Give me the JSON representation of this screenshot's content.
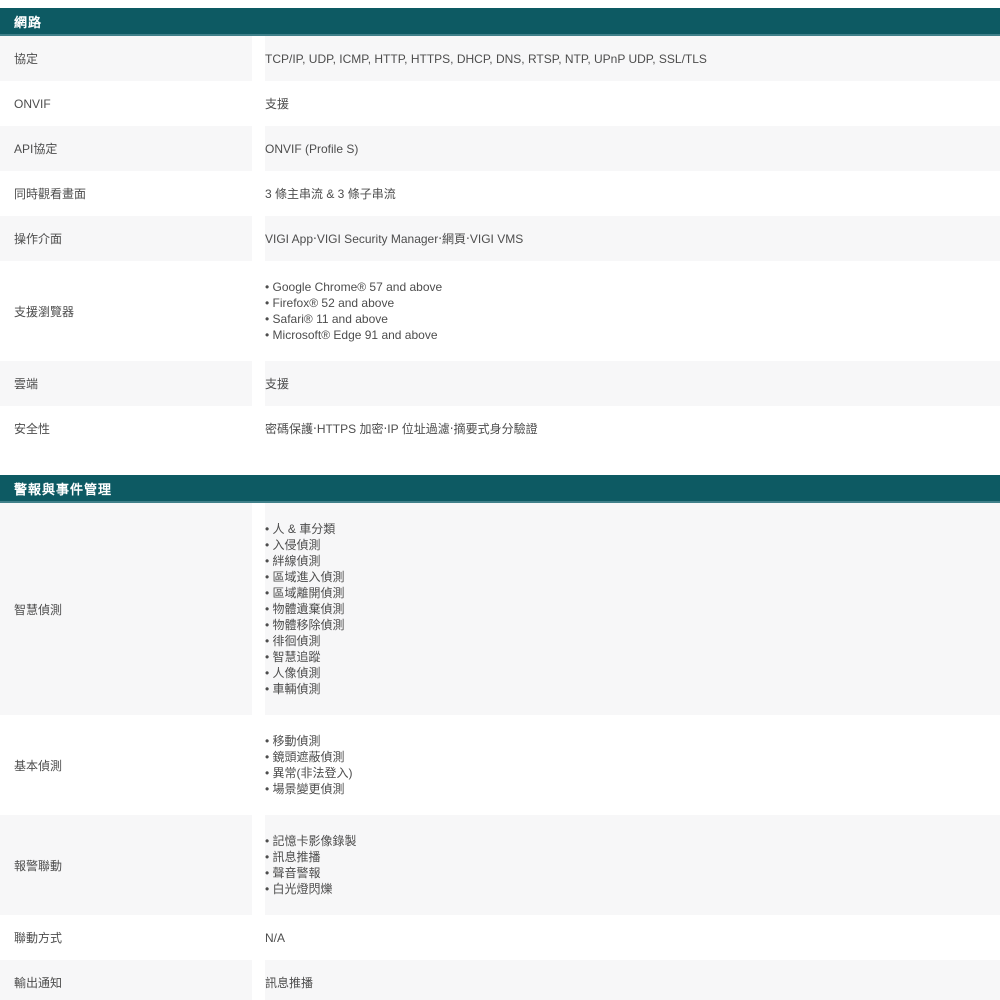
{
  "colors": {
    "header_bg": "#0d5a63",
    "header_text": "#ffffff",
    "alt_row_bg": "#f7f7f8",
    "body_text": "#4d4d4d"
  },
  "sections": [
    {
      "title": "網路",
      "rows": [
        {
          "label": "協定",
          "value": "TCP/IP, UDP, ICMP, HTTP, HTTPS, DHCP, DNS, RTSP, NTP, UPnP UDP, SSL/TLS"
        },
        {
          "label": "ONVIF",
          "value": "支援"
        },
        {
          "label": "API協定",
          "value": "ONVIF (Profile S)"
        },
        {
          "label": "同時觀看畫面",
          "value": "3 條主串流 & 3 條子串流"
        },
        {
          "label": "操作介面",
          "value": "VIGI App‧VIGI Security Manager‧網頁‧VIGI VMS"
        },
        {
          "label": "支援瀏覽器",
          "items": [
            "Google Chrome® 57 and above",
            "Firefox® 52 and above",
            "Safari® 11 and above",
            "Microsoft® Edge 91 and above"
          ]
        },
        {
          "label": "雲端",
          "value": "支援"
        },
        {
          "label": "安全性",
          "value": "密碼保護‧HTTPS 加密‧IP 位址過濾‧摘要式身分驗證"
        }
      ]
    },
    {
      "title": "警報與事件管理",
      "rows": [
        {
          "label": "智慧偵測",
          "items": [
            "人 & 車分類",
            "入侵偵測",
            "絆線偵測",
            "區域進入偵測",
            "區域離開偵測",
            "物體遺棄偵測",
            "物體移除偵測",
            "徘徊偵測",
            "智慧追蹤",
            "人像偵測",
            "車輛偵測"
          ]
        },
        {
          "label": "基本偵測",
          "items": [
            "移動偵測",
            "鏡頭遮蔽偵測",
            "異常(非法登入)",
            "場景變更偵測"
          ]
        },
        {
          "label": "報警聯動",
          "items": [
            "記憶卡影像錄製",
            "訊息推播",
            "聲音警報",
            "白光燈閃爍"
          ]
        },
        {
          "label": "聯動方式",
          "value": "N/A"
        },
        {
          "label": "輸出通知",
          "value": "訊息推播"
        }
      ]
    }
  ]
}
